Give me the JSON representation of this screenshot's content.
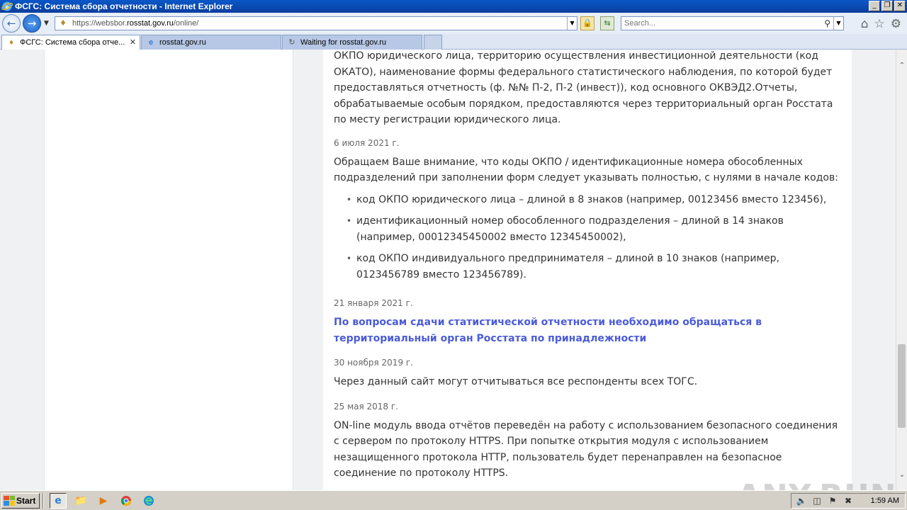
{
  "window": {
    "title": "ФСГС: Система сбора отчетности - Internet Explorer",
    "minimize": "_",
    "restore": "❐",
    "close": "✕"
  },
  "address": {
    "url_prefix": "https://websbor.",
    "url_domain": "rosstat.gov.ru",
    "url_path": "/online/"
  },
  "search": {
    "placeholder": "Search..."
  },
  "tabs": [
    {
      "label": "ФСГС: Система сбора отче...",
      "icon": "emblem-icon",
      "active": true,
      "close": "✕"
    },
    {
      "label": "rosstat.gov.ru",
      "icon": "ie-icon",
      "active": false
    },
    {
      "label": "Waiting for rosstat.gov.ru",
      "icon": "loading-icon",
      "active": false
    }
  ],
  "content": {
    "intro": "ОКПО юридического лица, территорию осуществления инвестиционной деятельности (код ОКАТО), наименование формы федерального статистического наблюдения, по которой будет предоставляться отчетность (ф. №№ П-2, П-2 (инвест)), код основного ОКВЭД2.Отчеты, обрабатываемые особым порядком, предоставляются через территориальный орган Росстата по месту регистрации юридического лица.",
    "news": [
      {
        "date": "6 июля 2021 г.",
        "text": "Обращаем Ваше внимание, что коды ОКПО / идентификационные номера обособленных подразделений при заполнении форм следует указывать полностью, с нулями в начале кодов:",
        "bullets": [
          "код ОКПО юридического лица – длиной в 8 знаков (например, 00123456 вместо 123456),",
          "идентификационный номер обособленного подразделения – длиной в 14 знаков (например, 00012345450002 вместо 12345450002),",
          "код ОКПО индивидуального предпринимателя – длиной в 10 знаков (например, 0123456789 вместо 123456789)."
        ]
      },
      {
        "date": "21 января 2021 г.",
        "link": "По вопросам сдачи статистической отчетности необходимо обращаться в территориальный орган Росстата по принадлежности"
      },
      {
        "date": "30 ноября 2019 г.",
        "text": "Через данный сайт могут отчитываться все респонденты всех ТОГС."
      },
      {
        "date": "25 мая 2018 г.",
        "text": "ON-line модуль ввода отчётов переведён на работу с использованием безопасного соединения с сервером по протоколу HTTPS. При попытке открытия модуля с использованием незащищенного протокола HTTP, пользователь будет перенаправлен на безопасное соединение по протоколу HTTPS."
      }
    ]
  },
  "watermark": "ANY.RUN",
  "taskbar": {
    "start_label": "Start",
    "clock": "1:59 AM"
  },
  "colors": {
    "link": "#4a5bd8",
    "titlebar": "#0a57c8",
    "page_bg": "#f0f1f3"
  }
}
